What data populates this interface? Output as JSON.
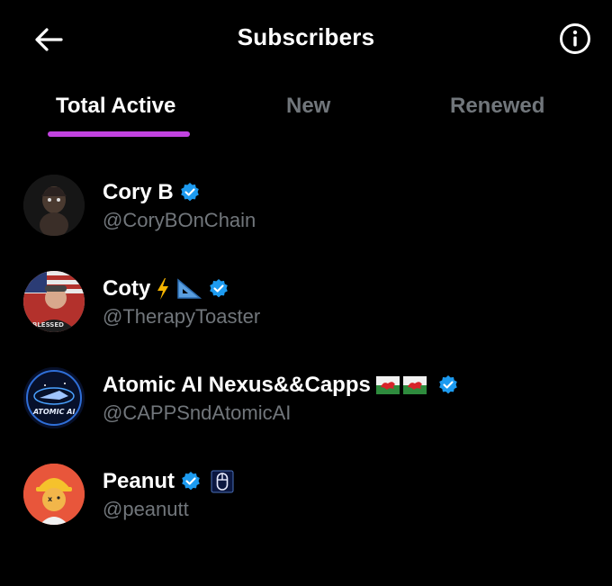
{
  "header": {
    "title": "Subscribers",
    "back_icon": "arrow-left-icon",
    "info_icon": "info-icon"
  },
  "tabs": [
    {
      "label": "Total Active",
      "active": true
    },
    {
      "label": "New",
      "active": false
    },
    {
      "label": "Renewed",
      "active": false
    }
  ],
  "colors": {
    "accent": "#c243e0",
    "verified": "#1d9bf0",
    "muted": "#71767b",
    "background": "#000000"
  },
  "subscribers": [
    {
      "name": "Cory B",
      "handle": "@CoryBOnChain",
      "verified": true,
      "extra_icons": []
    },
    {
      "name": "Coty",
      "handle": "@TherapyToaster",
      "verified": true,
      "extra_icons": [
        "lightning-emoji",
        "triangular-ruler-emoji"
      ]
    },
    {
      "name": "Atomic AI Nexus&&Capps",
      "handle": "@CAPPSndAtomicAI",
      "verified": true,
      "extra_icons": [
        "wales-flag-emoji",
        "wales-flag-emoji"
      ],
      "avatar_text": "ATOMIC AI"
    },
    {
      "name": "Peanut",
      "handle": "@peanutt",
      "verified": true,
      "extra_icons": [
        "computer-mouse-emoji"
      ]
    }
  ]
}
